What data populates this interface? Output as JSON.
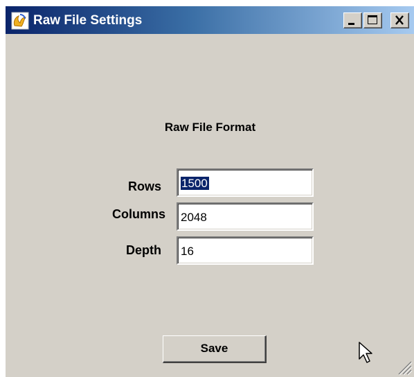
{
  "window": {
    "title": "Raw File Settings",
    "controls": [
      "minimize",
      "maximize",
      "close"
    ]
  },
  "form": {
    "heading": "Raw File Format",
    "fields": [
      {
        "label": "Rows",
        "value": "1500",
        "selected": true
      },
      {
        "label": "Columns",
        "value": "2048",
        "selected": false
      },
      {
        "label": "Depth",
        "value": "16",
        "selected": false
      }
    ],
    "save_label": "Save"
  },
  "icons": {
    "app": "app-icon",
    "minimize": "minimize-icon",
    "maximize": "maximize-icon",
    "close": "close-icon",
    "cursor": "mouse-pointer-icon",
    "resize": "resize-grip-icon"
  },
  "colors": {
    "titlebar_start": "#0a246a",
    "titlebar_end": "#a6caf0",
    "face": "#d4d0c8",
    "selection": "#0a246a"
  }
}
